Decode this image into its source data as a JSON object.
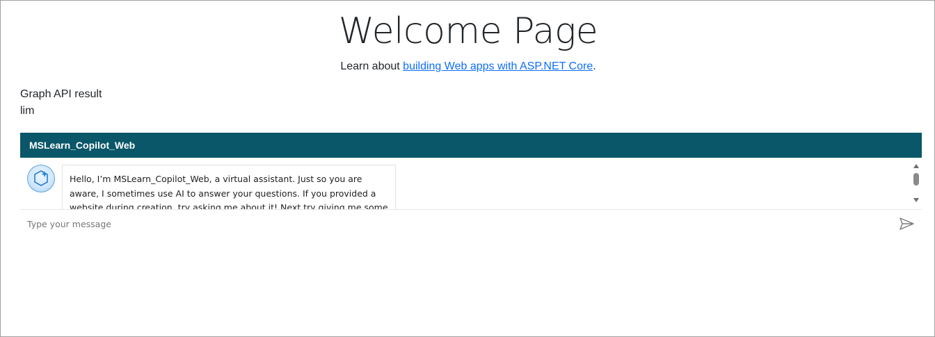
{
  "welcome": {
    "title": "Welcome Page",
    "subtitle_prefix": "Learn about ",
    "subtitle_link": "building Web apps with ASP.NET Core",
    "subtitle_suffix": "."
  },
  "graph": {
    "label": "Graph API result",
    "value": "lim"
  },
  "chat": {
    "title": "MSLearn_Copilot_Web",
    "bot_message": "Hello, I’m MSLearn_Copilot_Web, a virtual assistant. Just so you are aware, I sometimes use AI to answer your questions. If you provided a website during creation, try asking me about it! Next try giving me some more knowledge by",
    "input_placeholder": "Type your message",
    "input_value": "",
    "icons": {
      "avatar": "copilot-hexagon-sparkle-icon",
      "send": "send-arrow-icon",
      "scroll_up": "scroll-up-arrow-icon",
      "scroll_down": "scroll-down-arrow-icon"
    },
    "colors": {
      "header_bg": "#0a5769",
      "header_text": "#ffffff",
      "link": "#0d6efd"
    }
  }
}
